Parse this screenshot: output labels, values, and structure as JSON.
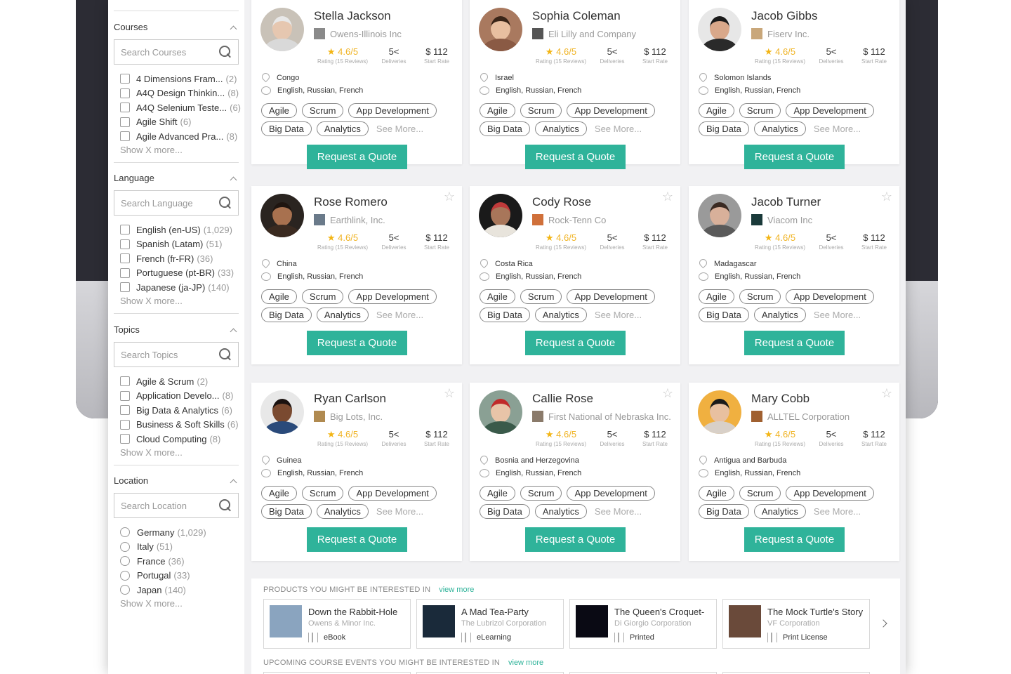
{
  "sidebar": {
    "sections": [
      {
        "title": "Courses",
        "placeholder": "Search Courses",
        "control": "checkbox",
        "options": [
          {
            "label": "4 Dimensions Fram...",
            "count": "(2)"
          },
          {
            "label": "A4Q Design Thinkin...",
            "count": "(8)"
          },
          {
            "label": "A4Q Selenium Teste...",
            "count": "(6)"
          },
          {
            "label": "Agile Shift",
            "count": "(6)"
          },
          {
            "label": "Agile Advanced Pra...",
            "count": "(8)"
          }
        ],
        "show_more": "Show X more..."
      },
      {
        "title": "Language",
        "placeholder": "Search Language",
        "control": "checkbox",
        "options": [
          {
            "label": "English (en-US)",
            "count": "(1,029)"
          },
          {
            "label": "Spanish (Latam)",
            "count": "(51)"
          },
          {
            "label": "French (fr-FR)",
            "count": "(36)"
          },
          {
            "label": "Portuguese (pt-BR)",
            "count": "(33)"
          },
          {
            "label": "Japanese (ja-JP)",
            "count": "(140)"
          }
        ],
        "show_more": "Show X more..."
      },
      {
        "title": "Topics",
        "placeholder": "Search Topics",
        "control": "checkbox",
        "options": [
          {
            "label": "Agile & Scrum",
            "count": "(2)"
          },
          {
            "label": "Application Develo...",
            "count": "(8)"
          },
          {
            "label": "Big Data & Analytics",
            "count": "(6)"
          },
          {
            "label": "Business & Soft Skills",
            "count": "(6)"
          },
          {
            "label": "Cloud Computing",
            "count": "(8)"
          }
        ],
        "show_more": "Show X more..."
      },
      {
        "title": "Location",
        "placeholder": "Search Location",
        "control": "radio",
        "options": [
          {
            "label": "Germany",
            "count": "(1,029)"
          },
          {
            "label": "Italy",
            "count": "(51)"
          },
          {
            "label": "France",
            "count": "(36)"
          },
          {
            "label": "Portugal",
            "count": "(33)"
          },
          {
            "label": "Japan",
            "count": "(140)"
          }
        ],
        "show_more": "Show X more..."
      }
    ]
  },
  "card_common": {
    "rating_value": "4.6/5",
    "rating_label": "Rating (15 Reviews)",
    "deliveries_value": "5<",
    "deliveries_label": "Deliveries",
    "rate_value": "$ 112",
    "rate_label": "Start Rate",
    "languages": "English, Russian, French",
    "tags_row1": [
      "Agile",
      "Scrum",
      "App Development"
    ],
    "tags_row2": [
      "Big Data",
      "Analytics"
    ],
    "see_more": "See More...",
    "quote_button": "Request a Quote",
    "star_icon": "star-outline-icon"
  },
  "trainers": [
    {
      "name": "Stella Jackson",
      "company": "Owens-Illinois Inc",
      "location": "Congo",
      "skin": "#e6c7b0",
      "hair": "#e8e8e8",
      "shirt": "#d9d9d9",
      "bg": "#c9c2b8",
      "logo": "#8a8a8a"
    },
    {
      "name": "Sophia Coleman",
      "company": "Eli Lilly and Company",
      "location": "Israel",
      "skin": "#e8bfa0",
      "hair": "#3a2518",
      "shirt": "#8a5a44",
      "bg": "#a9795f",
      "logo": "#555555"
    },
    {
      "name": "Jacob Gibbs",
      "company": "Fiserv Inc.",
      "location": "Solomon Islands",
      "skin": "#d9a88a",
      "hair": "#1a1a1a",
      "shirt": "#2a2a2a",
      "bg": "#e7e7e7",
      "logo": "#c9a77a"
    },
    {
      "name": "Rose Romero",
      "company": "Earthlink, Inc.",
      "location": "China",
      "skin": "#a8714f",
      "hair": "#1f1510",
      "shirt": "#3a2a20",
      "bg": "#2a2420",
      "logo": "#6a7a8a"
    },
    {
      "name": "Cody Rose",
      "company": "Rock-Tenn Co",
      "location": "Costa Rica",
      "skin": "#a8765a",
      "hair": "#c03a3a",
      "shirt": "#e8e4dc",
      "bg": "#1a1a1a",
      "logo": "#d0703a"
    },
    {
      "name": "Jacob Turner",
      "company": "Viacom Inc",
      "location": "Madagascar",
      "skin": "#d8b09a",
      "hair": "#3a2a22",
      "shirt": "#5a5a5a",
      "bg": "#9a9a9a",
      "logo": "#1a3a3a"
    },
    {
      "name": "Ryan Carlson",
      "company": "Big Lots, Inc.",
      "location": "Guinea",
      "skin": "#7a4a30",
      "hair": "#1a1210",
      "shirt": "#2a4a7a",
      "bg": "#e8e8e8",
      "logo": "#b08a50"
    },
    {
      "name": "Callie Rose",
      "company": "First National of Nebraska Inc.",
      "location": "Bosnia and Herzegovina",
      "skin": "#e8c4a8",
      "hair": "#c02a2a",
      "shirt": "#3a5a4a",
      "bg": "#8aa094",
      "logo": "#8a7a6a"
    },
    {
      "name": "Mary Cobb",
      "company": "ALLTEL Corporation",
      "location": "Antigua and Barbuda",
      "skin": "#e8c0a0",
      "hair": "#1a1a1a",
      "shirt": "#d8d0c8",
      "bg": "#f0b040",
      "logo": "#a06030"
    }
  ],
  "products": {
    "heading": "PRODUCTS YOU MIGHT BE INTERESTED IN",
    "view_more": "view more",
    "items": [
      {
        "title": "Down the Rabbit-Hole",
        "vendor": "Owens & Minor Inc.",
        "type": "eBook",
        "thumb": "#8aa4bf"
      },
      {
        "title": "A Mad Tea-Party",
        "vendor": "The Lubrizol Corporation",
        "type": "eLearning",
        "thumb": "#1a2a3a"
      },
      {
        "title": "The Queen's Croquet-",
        "vendor": "Di Giorgio Corporation",
        "type": "Printed",
        "thumb": "#0a0a14"
      },
      {
        "title": "The Mock Turtle's Story",
        "vendor": "VF Corporation",
        "type": "Print License",
        "thumb": "#6a4a3a"
      }
    ]
  },
  "events": {
    "heading": "UPCOMING COURSE EVENTS YOU MIGHT BE INTERESTED IN",
    "view_more": "view more"
  },
  "colors": {
    "accent": "#2fb39a",
    "rating": "#f0b323"
  }
}
